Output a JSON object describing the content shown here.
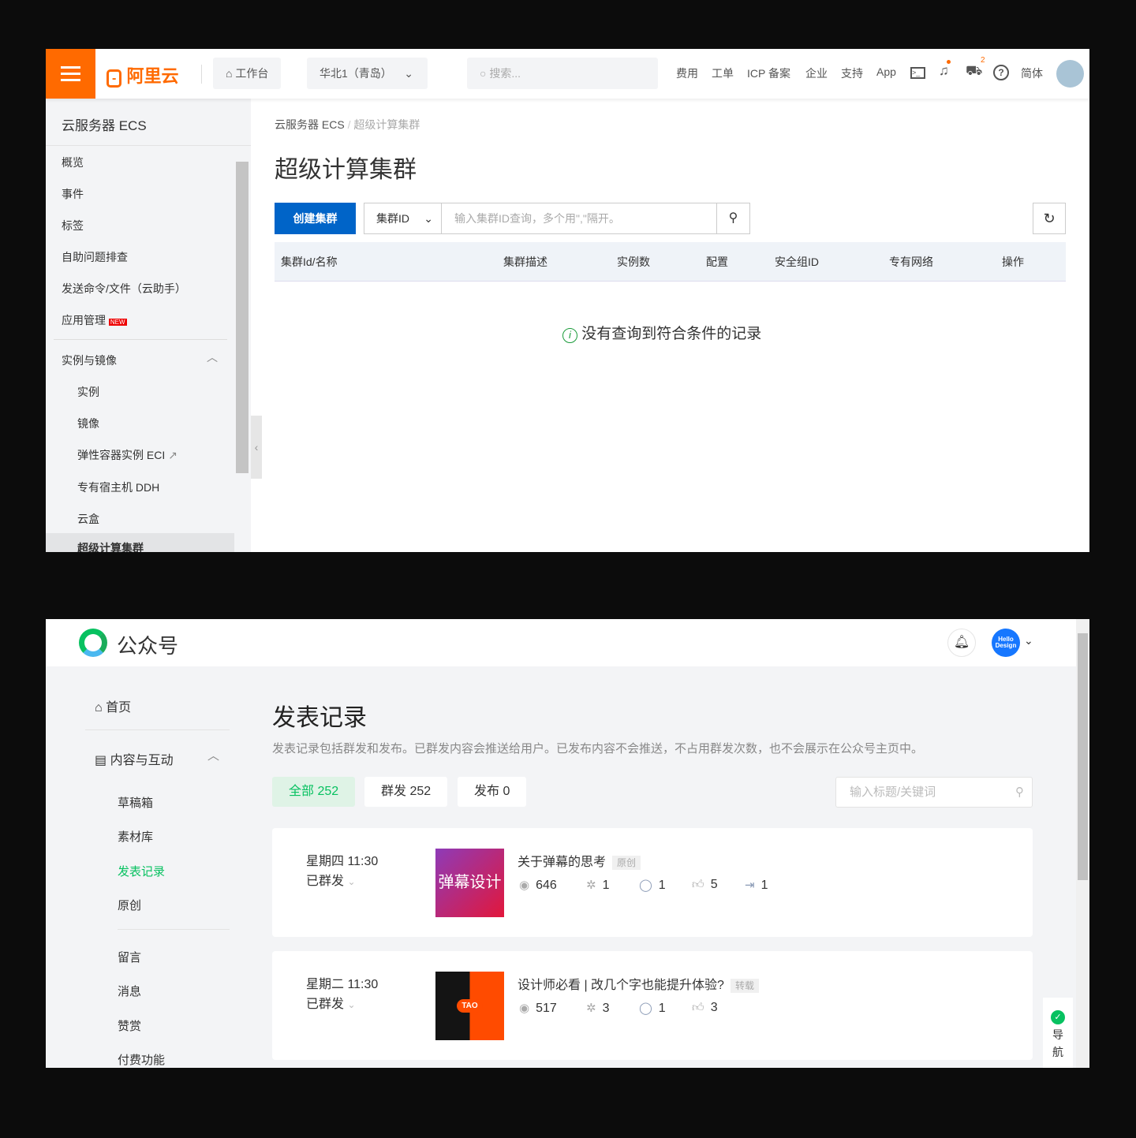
{
  "aliyun": {
    "logo": "阿里云",
    "workbench": "工作台",
    "region": "华北1（青岛）",
    "search_placeholder": "搜索...",
    "nav": [
      "费用",
      "工单",
      "ICP 备案",
      "企业",
      "支持",
      "App"
    ],
    "cart_count": "2",
    "lang": "简体",
    "accent": "#ff6a00",
    "sidebar": {
      "title": "云服务器 ECS",
      "items": [
        "概览",
        "事件",
        "标签",
        "自助问题排查",
        "发送命令/文件（云助手）",
        "应用管理"
      ],
      "new_badge": "NEW",
      "group": "实例与镜像",
      "sub": [
        "实例",
        "镜像",
        "弹性容器实例 ECI",
        "专有宿主机 DDH",
        "云盒",
        "超级计算集群"
      ]
    },
    "breadcrumb": [
      "云服务器 ECS",
      "超级计算集群"
    ],
    "title": "超级计算集群",
    "create_button": "创建集群",
    "filter_select": "集群ID",
    "filter_placeholder": "输入集群ID查询，多个用\",\"隔开。",
    "columns": [
      "集群Id/名称",
      "集群描述",
      "实例数",
      "配置",
      "安全组ID",
      "专有网络",
      "操作"
    ],
    "empty": "没有查询到符合条件的记录",
    "primary": "#0064c8"
  },
  "wechat": {
    "logo": "公众号",
    "avatar_text": "Hello Design",
    "sidebar": {
      "home": "首页",
      "group": "内容与互动",
      "sub": [
        "草稿箱",
        "素材库",
        "发表记录",
        "原创"
      ],
      "more": [
        "留言",
        "消息",
        "赞赏",
        "付费功能"
      ]
    },
    "title": "发表记录",
    "description": "发表记录包括群发和发布。已群发内容会推送给用户。已发布内容不会推送，不占用群发次数，也不会展示在公众号主页中。",
    "tabs": [
      "全部 252",
      "群发 252",
      "发布 0"
    ],
    "search_placeholder": "输入标题/关键词",
    "accent": "#07c160",
    "records": [
      {
        "time": "星期四 11:30",
        "status": "已群发",
        "thumb": "弹幕设计",
        "title": "关于弹幕的思考",
        "tag": "原创",
        "views": "646",
        "shares": "1",
        "comments": "1",
        "likes": "5",
        "forwards": "1"
      },
      {
        "time": "星期二 11:30",
        "status": "已群发",
        "thumb": "TAO",
        "title": "设计师必看 | 改几个字也能提升体验?",
        "tag": "转载",
        "views": "517",
        "shares": "3",
        "comments": "1",
        "likes": "3"
      }
    ],
    "guide": "导航"
  }
}
